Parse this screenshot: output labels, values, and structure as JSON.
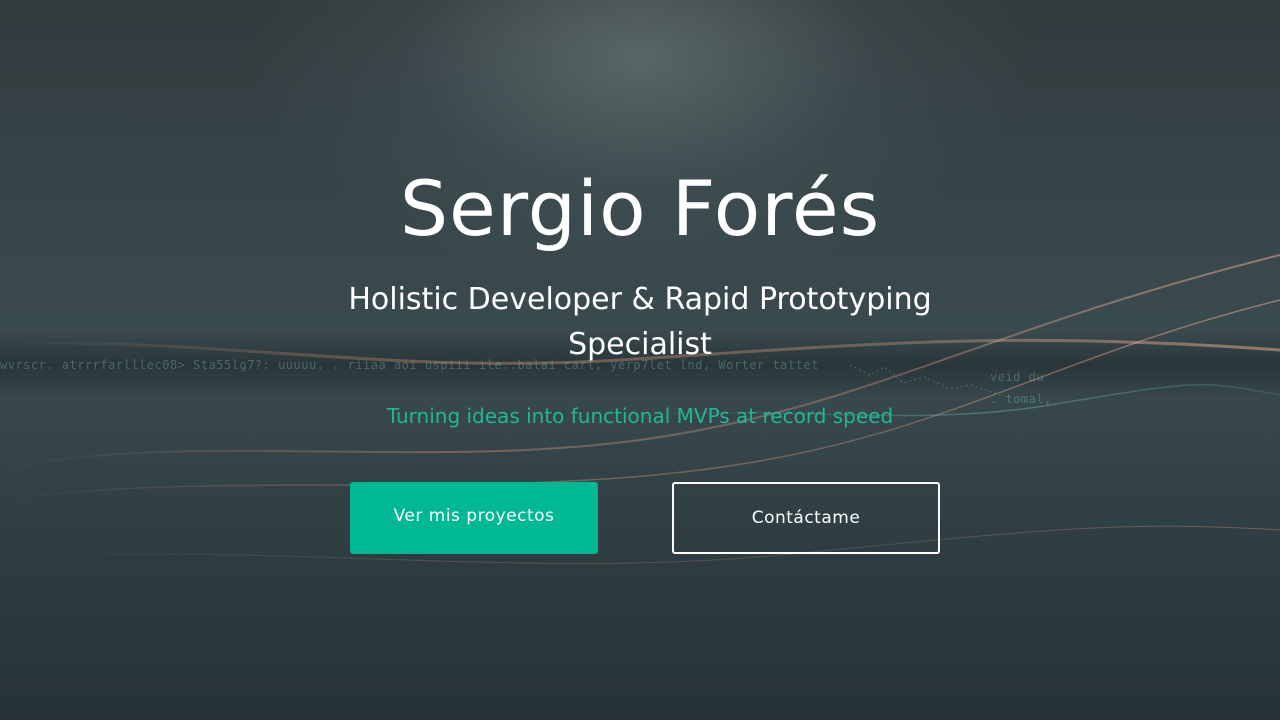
{
  "hero": {
    "name": "Sergio Forés",
    "role": "Holistic Developer & Rapid Prototyping Specialist",
    "tagline": "Turning ideas into functional MVPs at record speed"
  },
  "actions": {
    "projects_label": "Ver mis proyectos",
    "contact_label": "Contáctame"
  },
  "colors": {
    "accent": "#00b894",
    "tagline": "#1fb894",
    "background": "#2b3437",
    "text": "#ffffff"
  }
}
